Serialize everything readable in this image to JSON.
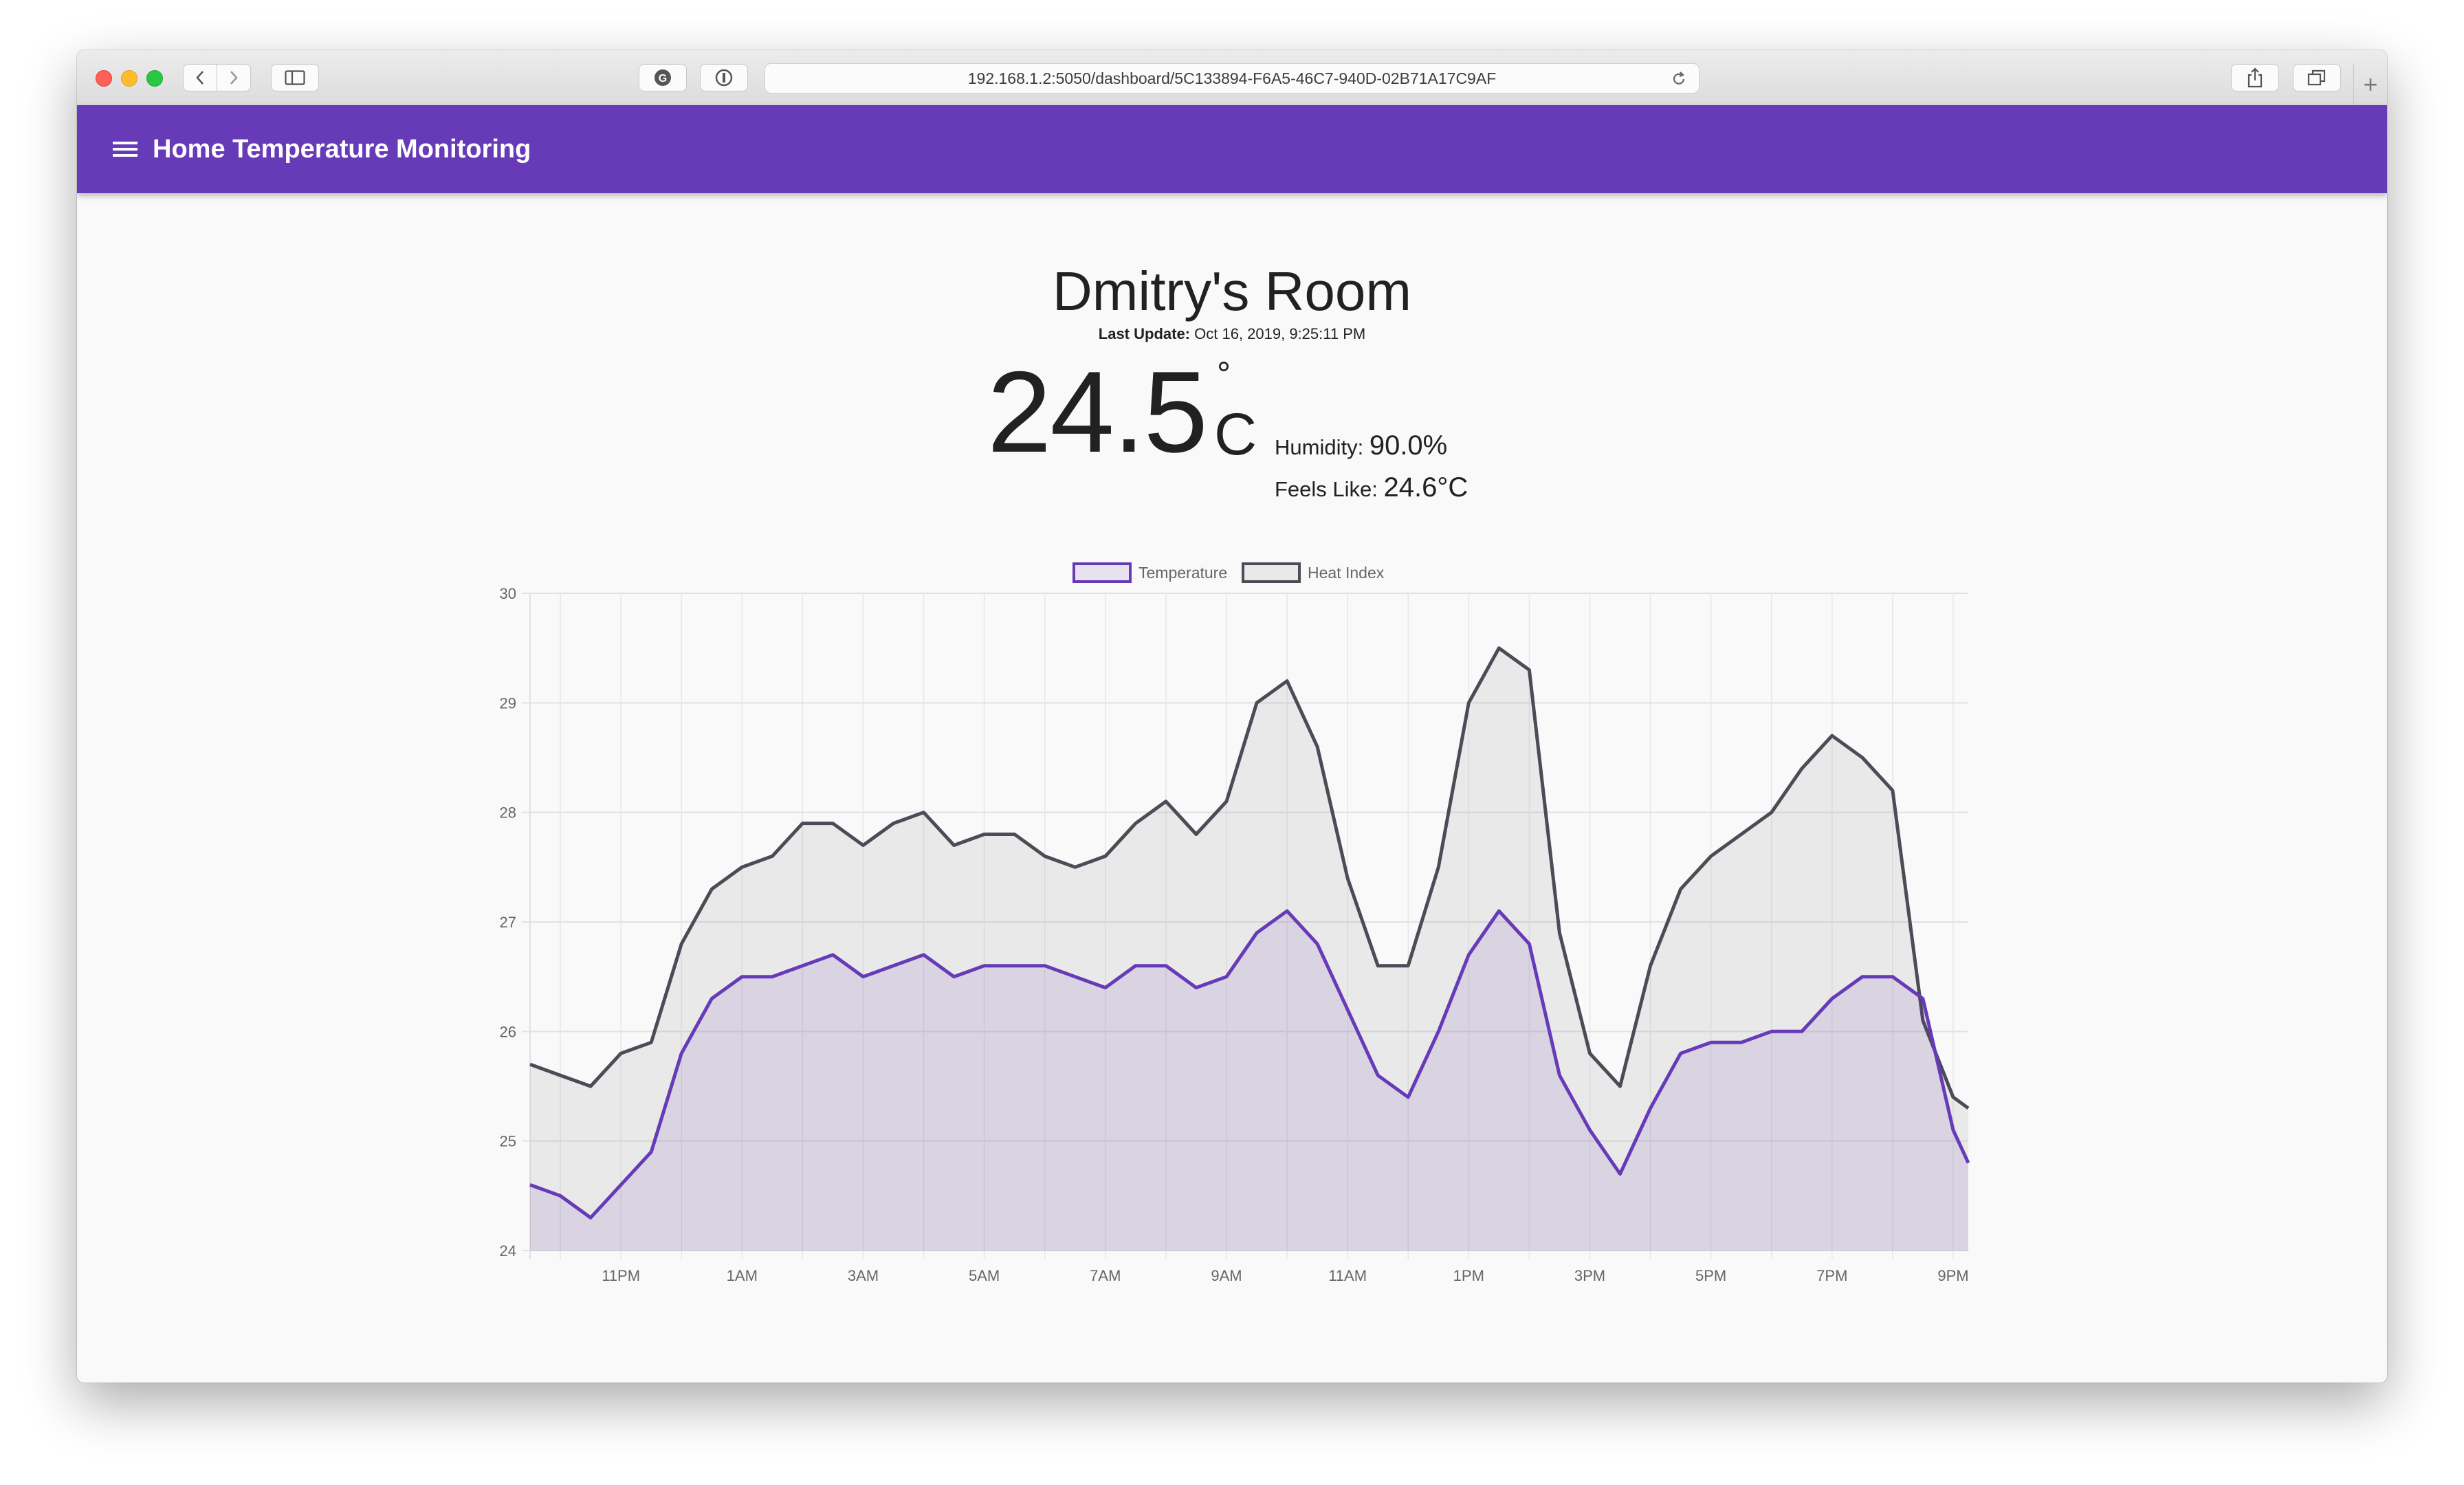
{
  "browser": {
    "url": "192.168.1.2:5050/dashboard/5C133894-F6A5-46C7-940D-02B71A17C9AF",
    "new_tab_label": "+"
  },
  "app": {
    "title": "Home Temperature Monitoring"
  },
  "room": {
    "name": "Dmitry's Room",
    "last_update_label": "Last Update:",
    "last_update_value": "Oct 16, 2019, 9:25:11 PM",
    "temperature": "24.5",
    "degree_symbol": "°",
    "unit": "C",
    "humidity_label": "Humidity:",
    "humidity_value": "90.0%",
    "feels_like_label": "Feels Like:",
    "feels_like_value": "24.6°C"
  },
  "colors": {
    "accent": "#673ab7",
    "temperature_line": "#673ab7",
    "heat_index_line": "#4a4c56"
  },
  "chart_data": {
    "type": "area",
    "ylim": [
      24,
      30
    ],
    "yticks": [
      "30",
      "29",
      "28",
      "27",
      "26",
      "25",
      "24"
    ],
    "xticks": [
      "11PM",
      "1AM",
      "3AM",
      "5AM",
      "7AM",
      "9AM",
      "11AM",
      "1PM",
      "3PM",
      "5PM",
      "7PM",
      "9PM"
    ],
    "grid": true,
    "legend_position": "top",
    "x": [
      "21:30",
      "22:00",
      "22:30",
      "23:00",
      "23:30",
      "00:00",
      "00:30",
      "01:00",
      "01:30",
      "02:00",
      "02:30",
      "03:00",
      "03:30",
      "04:00",
      "04:30",
      "05:00",
      "05:30",
      "06:00",
      "06:30",
      "07:00",
      "07:30",
      "08:00",
      "08:30",
      "09:00",
      "09:30",
      "10:00",
      "10:30",
      "11:00",
      "11:30",
      "12:00",
      "12:30",
      "13:00",
      "13:30",
      "14:00",
      "14:30",
      "15:00",
      "15:30",
      "16:00",
      "16:30",
      "17:00",
      "17:30",
      "18:00",
      "18:30",
      "19:00",
      "19:30",
      "20:00",
      "20:30",
      "21:00",
      "21:15"
    ],
    "series": [
      {
        "name": "Temperature",
        "values": [
          24.6,
          24.5,
          24.3,
          24.6,
          24.9,
          25.8,
          26.3,
          26.5,
          26.5,
          26.6,
          26.7,
          26.5,
          26.6,
          26.7,
          26.5,
          26.6,
          26.6,
          26.6,
          26.5,
          26.4,
          26.6,
          26.6,
          26.4,
          26.5,
          26.9,
          27.1,
          26.8,
          26.2,
          25.6,
          25.4,
          26.0,
          26.7,
          27.1,
          26.8,
          25.6,
          25.1,
          24.7,
          25.3,
          25.8,
          25.9,
          25.9,
          26.0,
          26.0,
          26.3,
          26.5,
          26.5,
          26.3,
          25.1,
          24.8
        ]
      },
      {
        "name": "Heat Index",
        "values": [
          25.7,
          25.6,
          25.5,
          25.8,
          25.9,
          26.8,
          27.3,
          27.5,
          27.6,
          27.9,
          27.9,
          27.7,
          27.9,
          28.0,
          27.7,
          27.8,
          27.8,
          27.6,
          27.5,
          27.6,
          27.9,
          28.1,
          27.8,
          28.1,
          29.0,
          29.2,
          28.6,
          27.4,
          26.6,
          26.6,
          27.5,
          29.0,
          29.5,
          29.3,
          26.9,
          25.8,
          25.5,
          26.6,
          27.3,
          27.6,
          27.8,
          28.0,
          28.4,
          28.7,
          28.5,
          28.2,
          26.1,
          25.4,
          25.3
        ]
      }
    ]
  }
}
